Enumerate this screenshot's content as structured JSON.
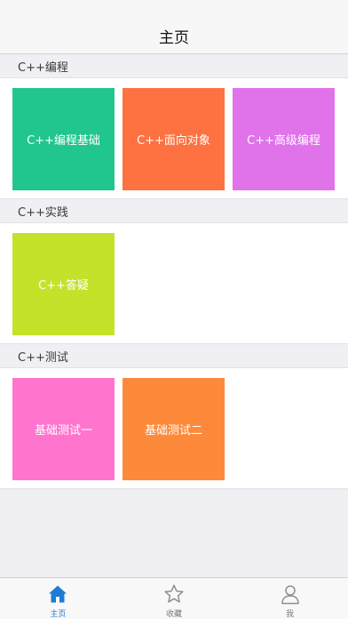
{
  "nav": {
    "title": "主页"
  },
  "sections": [
    {
      "title": "C++编程",
      "tiles": [
        {
          "label": "C++编程基础",
          "color": "#21c58e"
        },
        {
          "label": "C++面向对象",
          "color": "#fe7141"
        },
        {
          "label": "C++高级编程",
          "color": "#e072ea"
        }
      ]
    },
    {
      "title": "C++实践",
      "tiles": [
        {
          "label": "C++答疑",
          "color": "#c4e22a"
        }
      ]
    },
    {
      "title": "C++测试",
      "tiles": [
        {
          "label": "基础测试一",
          "color": "#ff75cd"
        },
        {
          "label": "基础测试二",
          "color": "#fd8a3a"
        }
      ]
    }
  ],
  "tabbar": [
    {
      "label": "主页",
      "icon": "home-icon",
      "active": true
    },
    {
      "label": "收藏",
      "icon": "star-icon",
      "active": false
    },
    {
      "label": "我",
      "icon": "user-icon",
      "active": false
    }
  ],
  "colors": {
    "accent": "#1e7bd6",
    "inactive": "#8e8e93"
  }
}
